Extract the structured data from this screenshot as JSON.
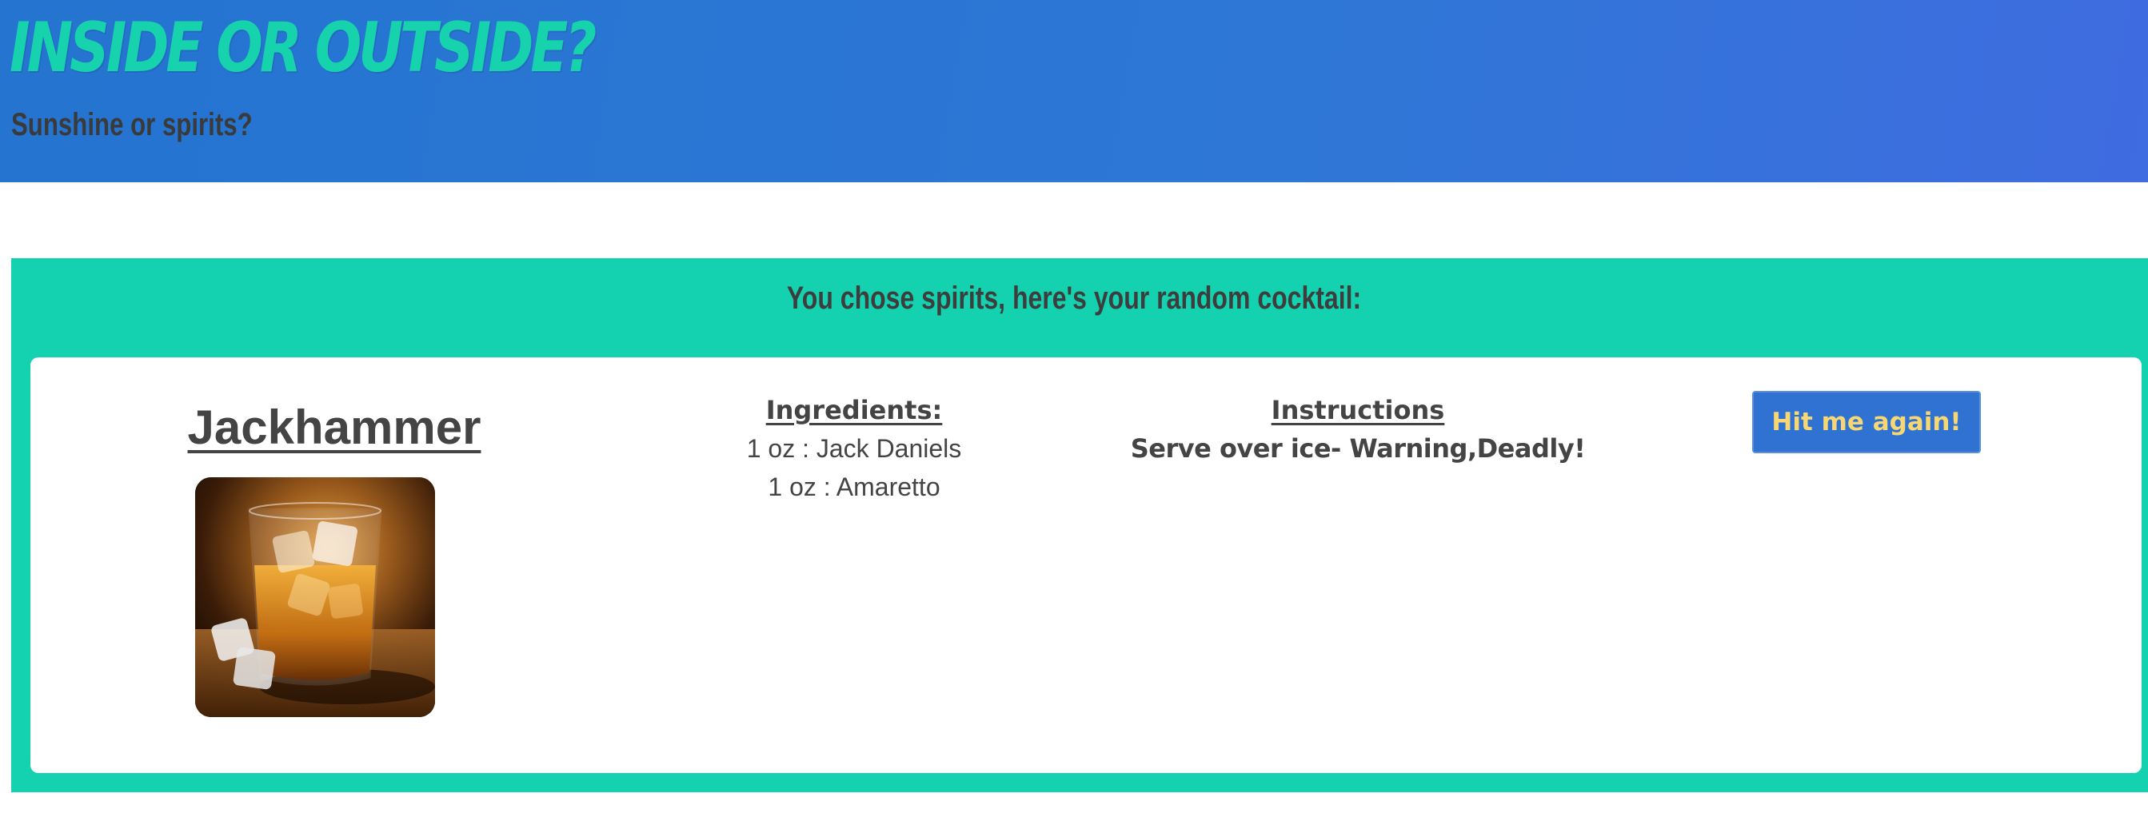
{
  "header": {
    "title": "INSIDE OR OUTSIDE?",
    "tagline": "Sunshine or spirits?"
  },
  "result": {
    "heading": "You chose spirits, here's your random cocktail:",
    "drink": {
      "name": "Jackhammer",
      "image_icon": "whiskey-glass-photo"
    },
    "ingredients": {
      "heading": "Ingredients:",
      "items": [
        "1 oz : Jack Daniels",
        "1 oz : Amaretto"
      ]
    },
    "instructions": {
      "heading": "Instructions",
      "text": "Serve over ice- Warning,Deadly!"
    },
    "button": {
      "label": "Hit me again!"
    }
  },
  "colors": {
    "header_bg": "#2e77d6",
    "title": "#16d3ad",
    "panel_bg": "#14d2b0",
    "button_bg": "#2f72d2",
    "button_text": "#f7d774",
    "text": "#444444"
  }
}
